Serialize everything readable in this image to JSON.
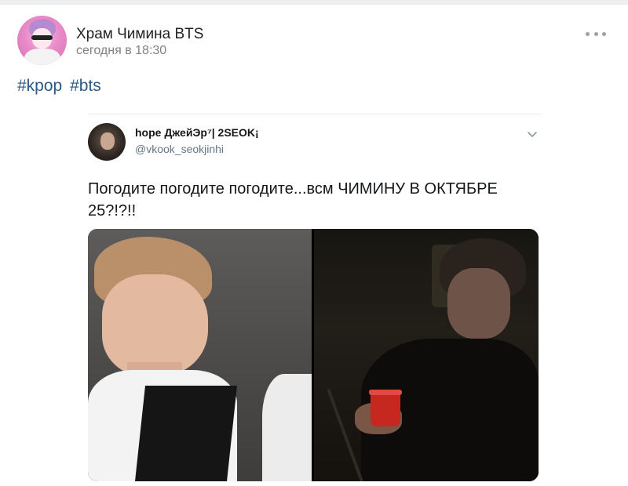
{
  "post": {
    "community_name": "Храм Чимина BTS",
    "time": "сегодня в 18:30",
    "hashtags": [
      "#kpop",
      "#bts"
    ]
  },
  "tweet": {
    "author": "hope ДжейЭр⁷| 2SEOK¡",
    "handle": "@vkook_seokjinhi",
    "text": "Погодите погодите погодите...всм ЧИМИНУ В ОКТЯБРЕ 25?!?!!"
  },
  "icons": {
    "more": "more-dots-icon",
    "tweet_menu": "chevron-down-icon"
  },
  "colors": {
    "link": "#2a5885",
    "secondary_text": "#828282",
    "handle_text": "#657786"
  }
}
